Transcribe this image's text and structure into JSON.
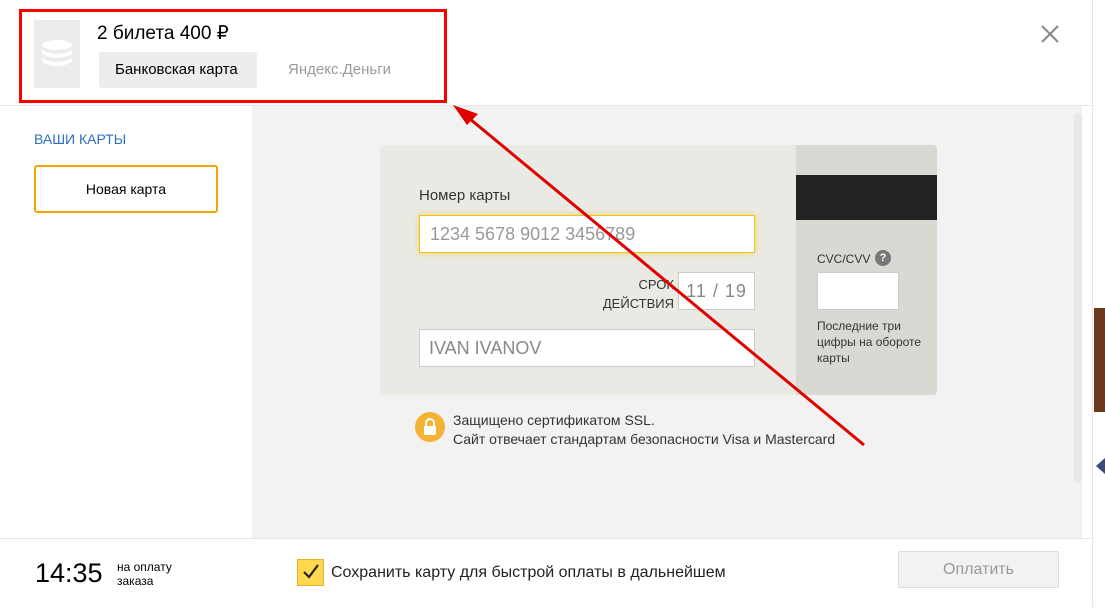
{
  "header": {
    "order_title": "2 билета 400 ₽",
    "tabs": [
      {
        "label": "Банковская карта",
        "active": true
      },
      {
        "label": "Яндекс.Деньги",
        "active": false
      }
    ],
    "close_icon": "close-icon"
  },
  "sidebar": {
    "title": "ВАШИ КАРТЫ",
    "new_card_label": "Новая карта"
  },
  "card_form": {
    "number_label": "Номер карты",
    "number_placeholder": "1234 5678 9012 3456789",
    "expiry_label": "СРОК ДЕЙСТВИЯ",
    "expiry_value": "11 / 19",
    "holder_value": "IVAN IVANOV",
    "cvc_label": "CVC/CVV",
    "cvc_help": "?",
    "cvc_hint": "Последние три цифры на обороте карты"
  },
  "security": {
    "line1": "Защищено сертификатом SSL.",
    "line2": "Сайт отвечает стандартам безопасности Visa и Mastercard"
  },
  "footer": {
    "timer": "14:35",
    "timer_label_1": "на оплату",
    "timer_label_2": "заказа",
    "save_label": "Сохранить карту для быстрой оплаты в дальнейшем",
    "save_checked": true,
    "pay_label": "Оплатить"
  },
  "colors": {
    "accent_link": "#2d6fc0",
    "accent_yellow": "#f0a500",
    "annotation_red": "#ff0000"
  }
}
